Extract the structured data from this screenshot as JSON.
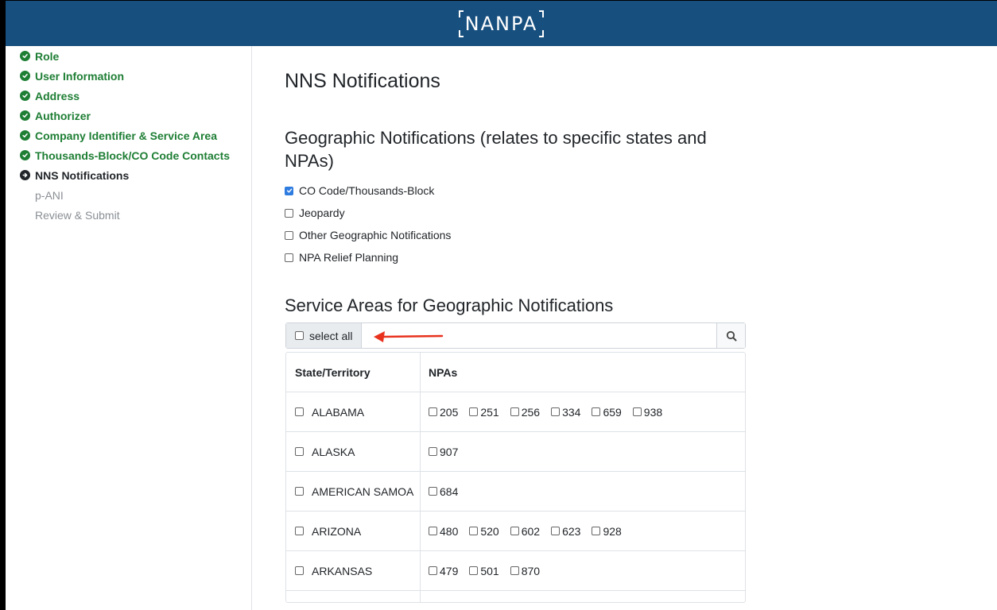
{
  "header": {
    "logo_text": "NANPA"
  },
  "sidebar": {
    "items": [
      {
        "label": "Role",
        "status": "done"
      },
      {
        "label": "User Information",
        "status": "done"
      },
      {
        "label": "Address",
        "status": "done"
      },
      {
        "label": "Authorizer",
        "status": "done"
      },
      {
        "label": "Company Identifier & Service Area",
        "status": "done"
      },
      {
        "label": "Thousands-Block/CO Code Contacts",
        "status": "done"
      },
      {
        "label": "NNS Notifications",
        "status": "current"
      },
      {
        "label": "p-ANI",
        "status": "future"
      },
      {
        "label": "Review & Submit",
        "status": "future"
      }
    ]
  },
  "main": {
    "title": "NNS Notifications",
    "geo_heading": "Geographic Notifications (relates to specific states and NPAs)",
    "geo_options": [
      {
        "label": "CO Code/Thousands-Block",
        "checked": true
      },
      {
        "label": "Jeopardy",
        "checked": false
      },
      {
        "label": "Other Geographic Notifications",
        "checked": false
      },
      {
        "label": "NPA Relief Planning",
        "checked": false
      }
    ],
    "service_heading": "Service Areas for Geographic Notifications",
    "select_all_label": "select all",
    "search_placeholder": "",
    "table": {
      "headers": [
        "State/Territory",
        "NPAs"
      ],
      "rows": [
        {
          "state": "ALABAMA",
          "npas": [
            "205",
            "251",
            "256",
            "334",
            "659",
            "938"
          ]
        },
        {
          "state": "ALASKA",
          "npas": [
            "907"
          ]
        },
        {
          "state": "AMERICAN SAMOA",
          "npas": [
            "684"
          ]
        },
        {
          "state": "ARIZONA",
          "npas": [
            "480",
            "520",
            "602",
            "623",
            "928"
          ]
        },
        {
          "state": "ARKANSAS",
          "npas": [
            "479",
            "501",
            "870"
          ]
        }
      ]
    }
  },
  "colors": {
    "header_bg": "#174f7e",
    "done_green": "#1e7e34",
    "checkbox_blue": "#2f7ce0",
    "arrow_red": "#e8321e"
  }
}
